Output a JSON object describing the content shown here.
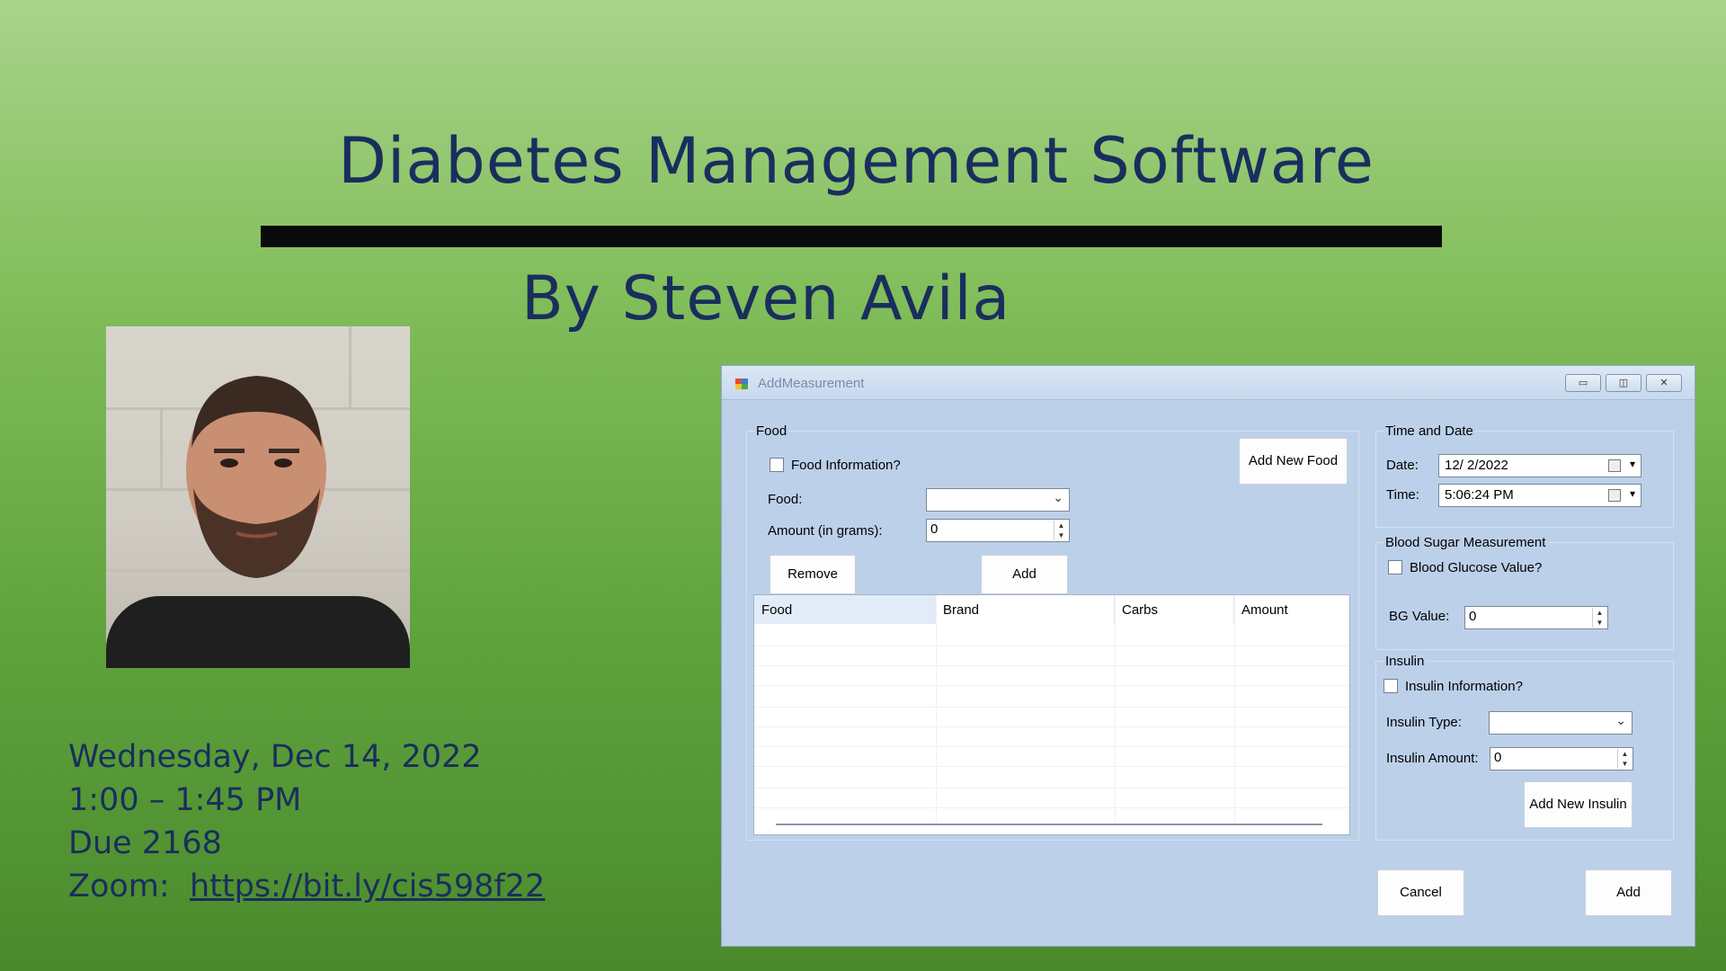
{
  "slide": {
    "title": "Diabetes Management Software",
    "author": "By Steven Avila",
    "date": "Wednesday, Dec 14, 2022",
    "time": "1:00 – 1:45 PM",
    "room": "Due 2168",
    "zoom_label": "Zoom:",
    "zoom_link": "https://bit.ly/cis598f22"
  },
  "window": {
    "title": "AddMeasurement",
    "food": {
      "group_label": "Food",
      "info_checkbox": "Food Information?",
      "food_label": "Food:",
      "food_value": "",
      "amount_label": "Amount (in grams):",
      "amount_value": "0",
      "add_new_food_button": "Add New Food",
      "remove_button": "Remove",
      "add_button": "Add",
      "table_columns": [
        "Food",
        "Brand",
        "Carbs",
        "Amount"
      ]
    },
    "time_date": {
      "group_label": "Time and Date",
      "date_label": "Date:",
      "date_value": "12/  2/2022",
      "time_label": "Time:",
      "time_value": "5:06:24 PM"
    },
    "blood_sugar": {
      "group_label": "Blood Sugar Measurement",
      "checkbox": "Blood Glucose Value?",
      "bg_label": "BG Value:",
      "bg_value": "0"
    },
    "insulin": {
      "group_label": "Insulin",
      "checkbox": "Insulin Information?",
      "type_label": "Insulin Type:",
      "type_value": "",
      "amount_label": "Insulin Amount:",
      "amount_value": "0",
      "add_new_button": "Add New Insulin"
    },
    "cancel_button": "Cancel",
    "add_button": "Add"
  },
  "colors": {
    "title_text": "#1a2e5e",
    "window_bg": "#bcd0ea"
  }
}
